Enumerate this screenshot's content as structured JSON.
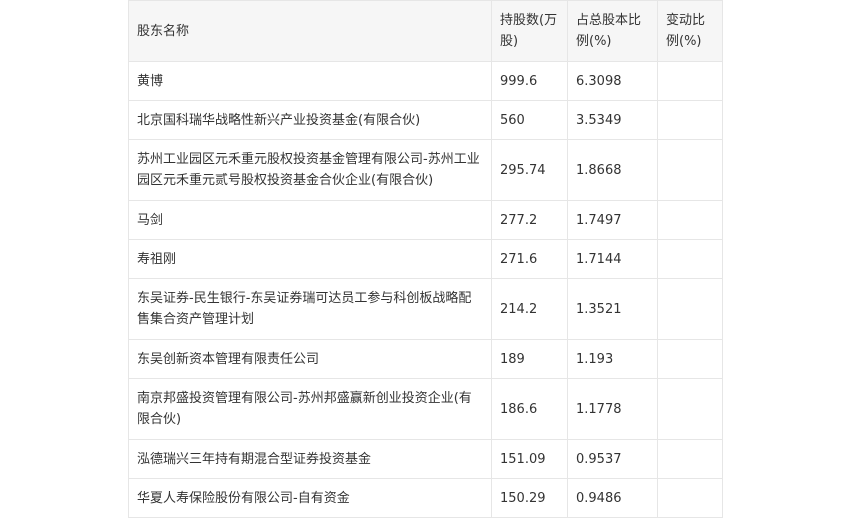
{
  "table": {
    "headers": [
      "股东名称",
      "持股数(万股)",
      "占总股本比例(%)",
      "变动比例(%)"
    ],
    "rows": [
      {
        "name": "黄博",
        "shares": "999.6",
        "ratio": "6.3098",
        "change": ""
      },
      {
        "name": "北京国科瑞华战略性新兴产业投资基金(有限合伙)",
        "shares": "560",
        "ratio": "3.5349",
        "change": ""
      },
      {
        "name": "苏州工业园区元禾重元股权投资基金管理有限公司-苏州工业园区元禾重元贰号股权投资基金合伙企业(有限合伙)",
        "shares": "295.74",
        "ratio": "1.8668",
        "change": ""
      },
      {
        "name": "马剑",
        "shares": "277.2",
        "ratio": "1.7497",
        "change": ""
      },
      {
        "name": "寿祖刚",
        "shares": "271.6",
        "ratio": "1.7144",
        "change": ""
      },
      {
        "name": "东吴证券-民生银行-东吴证券瑞可达员工参与科创板战略配售集合资产管理计划",
        "shares": "214.2",
        "ratio": "1.3521",
        "change": ""
      },
      {
        "name": "东吴创新资本管理有限责任公司",
        "shares": "189",
        "ratio": "1.193",
        "change": ""
      },
      {
        "name": "南京邦盛投资管理有限公司-苏州邦盛赢新创业投资企业(有限合伙)",
        "shares": "186.6",
        "ratio": "1.1778",
        "change": ""
      },
      {
        "name": "泓德瑞兴三年持有期混合型证券投资基金",
        "shares": "151.09",
        "ratio": "0.9537",
        "change": ""
      },
      {
        "name": "华夏人寿保险股份有限公司-自有资金",
        "shares": "150.29",
        "ratio": "0.9486",
        "change": ""
      }
    ]
  }
}
